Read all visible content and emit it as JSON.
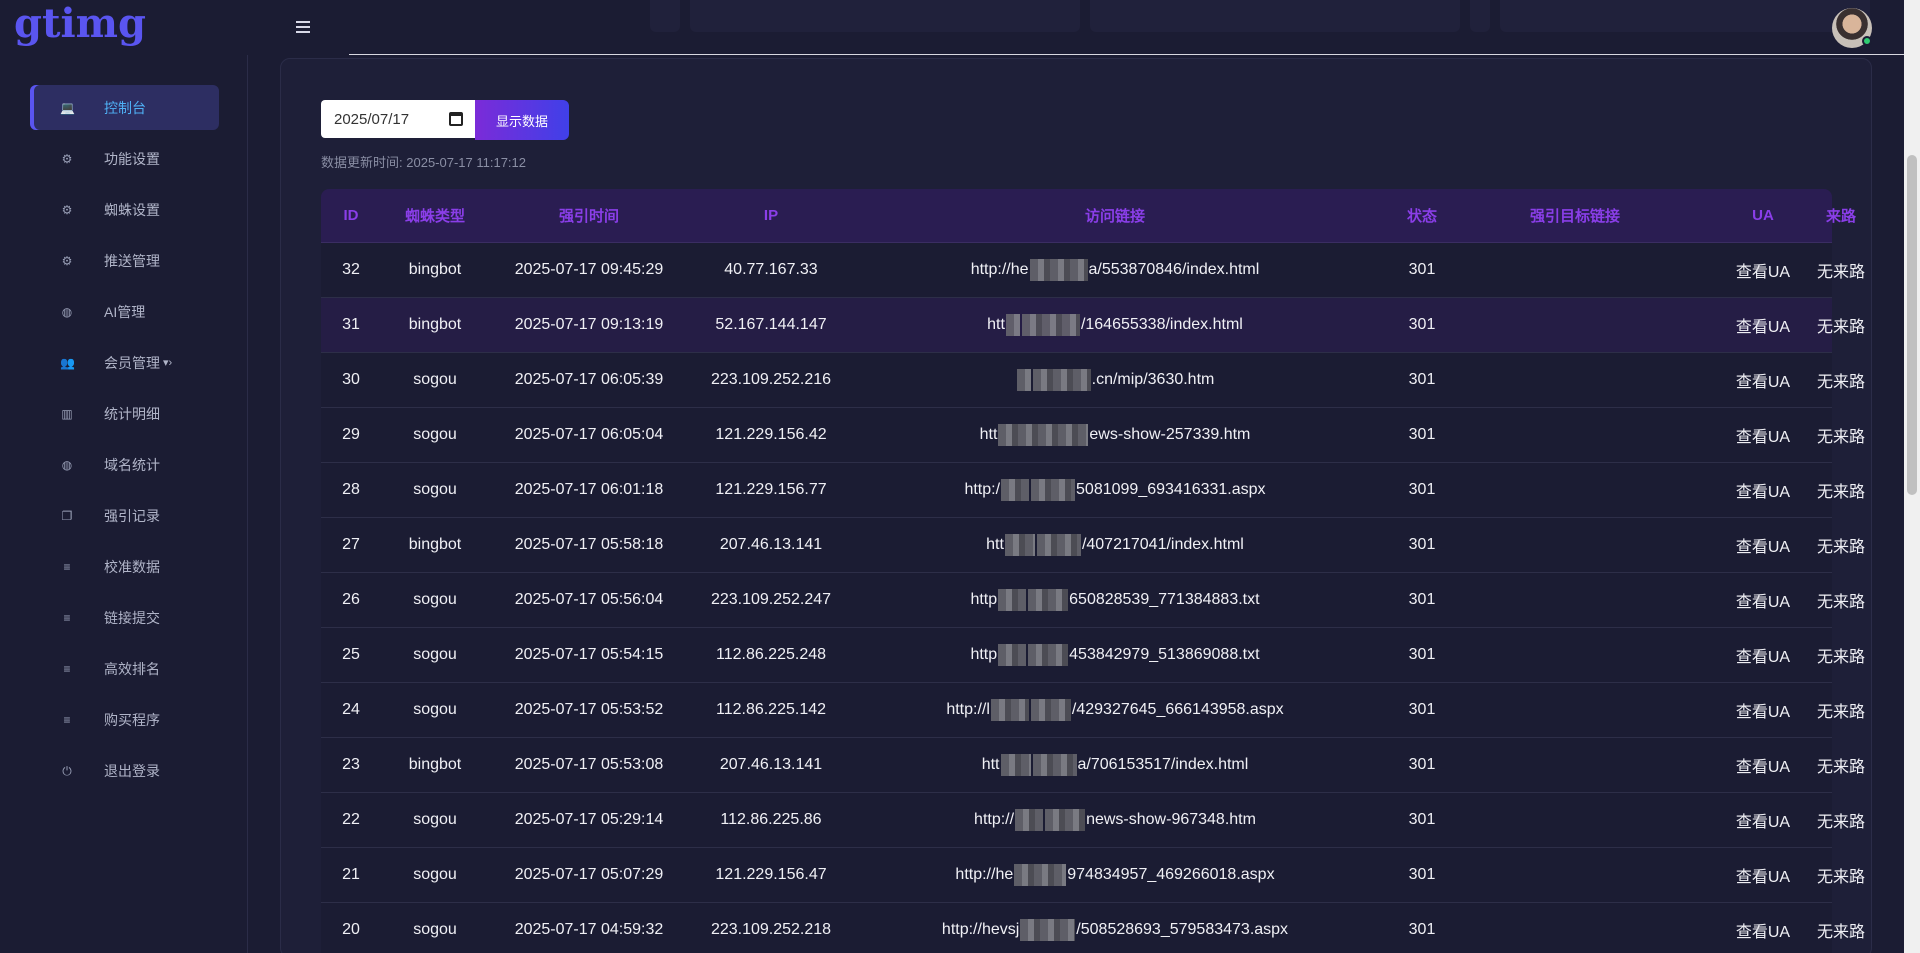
{
  "header": {
    "logo": "gtimg"
  },
  "sidebar": {
    "items": [
      {
        "label": "控制台",
        "icon": "laptop-icon",
        "glyph": "💻",
        "active": true
      },
      {
        "label": "功能设置",
        "icon": "cogs-icon",
        "glyph": "⚙"
      },
      {
        "label": "蜘蛛设置",
        "icon": "cogs-icon",
        "glyph": "⚙"
      },
      {
        "label": "推送管理",
        "icon": "cogs-icon",
        "glyph": "⚙"
      },
      {
        "label": "AI管理",
        "icon": "globe-icon",
        "glyph": "◍"
      },
      {
        "label": "会员管理",
        "icon": "users-icon",
        "glyph": "👥",
        "caret": "▾›"
      },
      {
        "label": "统计明细",
        "icon": "bar-chart-icon",
        "glyph": "▥"
      },
      {
        "label": "域名统计",
        "icon": "globe-icon",
        "glyph": "◍"
      },
      {
        "label": "强引记录",
        "icon": "copy-icon",
        "glyph": "❐"
      },
      {
        "label": "校准数据",
        "icon": "list-icon",
        "glyph": "≡"
      },
      {
        "label": "链接提交",
        "icon": "list-icon",
        "glyph": "≡"
      },
      {
        "label": "高效排名",
        "icon": "list-icon",
        "glyph": "≡"
      },
      {
        "label": "购买程序",
        "icon": "list-icon",
        "glyph": "≡"
      },
      {
        "label": "退出登录",
        "icon": "power-icon",
        "glyph": "⏻"
      }
    ]
  },
  "filter": {
    "date_value": "2025/07/17",
    "show_button": "显示数据",
    "update_label": "数据更新时间:",
    "update_time": "2025-07-17 11:17:12"
  },
  "table": {
    "headers": [
      "ID",
      "蜘蛛类型",
      "强引时间",
      "IP",
      "访问链接",
      "状态",
      "强引目标链接",
      "UA",
      "来路"
    ],
    "rows": [
      {
        "id": "32",
        "type": "bingbot",
        "time": "2025-07-17 09:45:29",
        "ip": "40.77.167.33",
        "url_pre": "http://he",
        "url_post": "a/553870846/index.html",
        "status": "301",
        "target": "",
        "ua": "查看UA",
        "src": "无来路"
      },
      {
        "id": "31",
        "type": "bingbot",
        "time": "2025-07-17 09:13:19",
        "ip": "52.167.144.147",
        "url_pre": "htt",
        "url_post": "/164655338/index.html",
        "status": "301",
        "target": "",
        "ua": "查看UA",
        "src": "无来路"
      },
      {
        "id": "30",
        "type": "sogou",
        "time": "2025-07-17 06:05:39",
        "ip": "223.109.252.216",
        "url_pre": "",
        "url_post": ".cn/mip/3630.htm",
        "status": "301",
        "target": "",
        "ua": "查看UA",
        "src": "无来路"
      },
      {
        "id": "29",
        "type": "sogou",
        "time": "2025-07-17 06:05:04",
        "ip": "121.229.156.42",
        "url_pre": "htt",
        "url_post": "ews-show-257339.htm",
        "status": "301",
        "target": "",
        "ua": "查看UA",
        "src": "无来路"
      },
      {
        "id": "28",
        "type": "sogou",
        "time": "2025-07-17 06:01:18",
        "ip": "121.229.156.77",
        "url_pre": "http:/",
        "url_post": "5081099_693416331.aspx",
        "status": "301",
        "target": "",
        "ua": "查看UA",
        "src": "无来路"
      },
      {
        "id": "27",
        "type": "bingbot",
        "time": "2025-07-17 05:58:18",
        "ip": "207.46.13.141",
        "url_pre": "htt",
        "url_post": "/407217041/index.html",
        "status": "301",
        "target": "",
        "ua": "查看UA",
        "src": "无来路"
      },
      {
        "id": "26",
        "type": "sogou",
        "time": "2025-07-17 05:56:04",
        "ip": "223.109.252.247",
        "url_pre": "http",
        "url_post": "650828539_771384883.txt",
        "status": "301",
        "target": "",
        "ua": "查看UA",
        "src": "无来路"
      },
      {
        "id": "25",
        "type": "sogou",
        "time": "2025-07-17 05:54:15",
        "ip": "112.86.225.248",
        "url_pre": "http",
        "url_post": "453842979_513869088.txt",
        "status": "301",
        "target": "",
        "ua": "查看UA",
        "src": "无来路"
      },
      {
        "id": "24",
        "type": "sogou",
        "time": "2025-07-17 05:53:52",
        "ip": "112.86.225.142",
        "url_pre": "http://l",
        "url_post": "/429327645_666143958.aspx",
        "status": "301",
        "target": "",
        "ua": "查看UA",
        "src": "无来路"
      },
      {
        "id": "23",
        "type": "bingbot",
        "time": "2025-07-17 05:53:08",
        "ip": "207.46.13.141",
        "url_pre": "htt",
        "url_post": "a/706153517/index.html",
        "status": "301",
        "target": "",
        "ua": "查看UA",
        "src": "无来路"
      },
      {
        "id": "22",
        "type": "sogou",
        "time": "2025-07-17 05:29:14",
        "ip": "112.86.225.86",
        "url_pre": "http://",
        "url_post": "news-show-967348.htm",
        "status": "301",
        "target": "",
        "ua": "查看UA",
        "src": "无来路"
      },
      {
        "id": "21",
        "type": "sogou",
        "time": "2025-07-17 05:07:29",
        "ip": "121.229.156.47",
        "url_pre": "http://he",
        "url_post": "974834957_469266018.aspx",
        "status": "301",
        "target": "",
        "ua": "查看UA",
        "src": "无来路"
      },
      {
        "id": "20",
        "type": "sogou",
        "time": "2025-07-17 04:59:32",
        "ip": "223.109.252.218",
        "url_pre": "http://hevsj",
        "url_post": "/508528693_579583473.aspx",
        "status": "301",
        "target": "",
        "ua": "查看UA",
        "src": "无来路"
      }
    ]
  }
}
